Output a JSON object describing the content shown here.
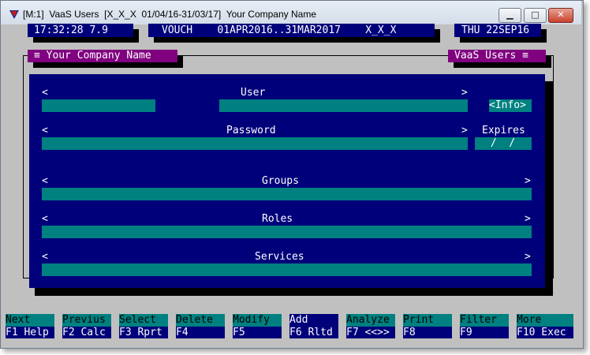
{
  "window": {
    "title": "[M:1]  VaaS Users  [X_X_X  01/04/16-31/03/17]  Your Company Name",
    "minimize_label": "▁",
    "maximize_label": "□",
    "close_label": "✕"
  },
  "status_bar": {
    "clock": "17:32:28 7.9",
    "voucher": "VOUCH    01APR2016..31MAR2017    X_X_X",
    "date": "THU 22SEP16"
  },
  "panel": {
    "left_tab": "≡ Your Company Name",
    "right_tab": "VaaS Users ≡"
  },
  "form": {
    "user": {
      "label": "User",
      "left_arrow": "<",
      "right_arrow": ">",
      "prefix_value": "",
      "value": ""
    },
    "info_button": "<Info>",
    "password": {
      "label": "Password",
      "left_arrow": "<",
      "right_arrow": ">",
      "value": ""
    },
    "expires": {
      "label": "Expires",
      "value": " /  /"
    },
    "groups": {
      "label": "Groups",
      "left_arrow": "<",
      "right_arrow": ">",
      "value": ""
    },
    "roles": {
      "label": "Roles",
      "left_arrow": "<",
      "right_arrow": ">",
      "value": ""
    },
    "services": {
      "label": "Services",
      "left_arrow": "<",
      "right_arrow": ">",
      "value": ""
    }
  },
  "function_keys": [
    {
      "top": "Next",
      "bottom": "F1 Help"
    },
    {
      "top": "Previus",
      "bottom": "F2 Calc"
    },
    {
      "top": "Select",
      "bottom": "F3 Rprt"
    },
    {
      "top": "Delete",
      "bottom": "F4"
    },
    {
      "top": "Modify",
      "bottom": "F5"
    },
    {
      "top": "Add",
      "bottom": "F6 Rltd"
    },
    {
      "top": "Analyze",
      "bottom": "F7 <<>>"
    },
    {
      "top": "Print",
      "bottom": "F8"
    },
    {
      "top": "Filter",
      "bottom": "F9"
    },
    {
      "top": "More",
      "bottom": "F10 Exec"
    }
  ],
  "colors": {
    "navy": "#00007a",
    "teal": "#008080",
    "purple": "#800080",
    "gray": "#c0c0c0"
  }
}
